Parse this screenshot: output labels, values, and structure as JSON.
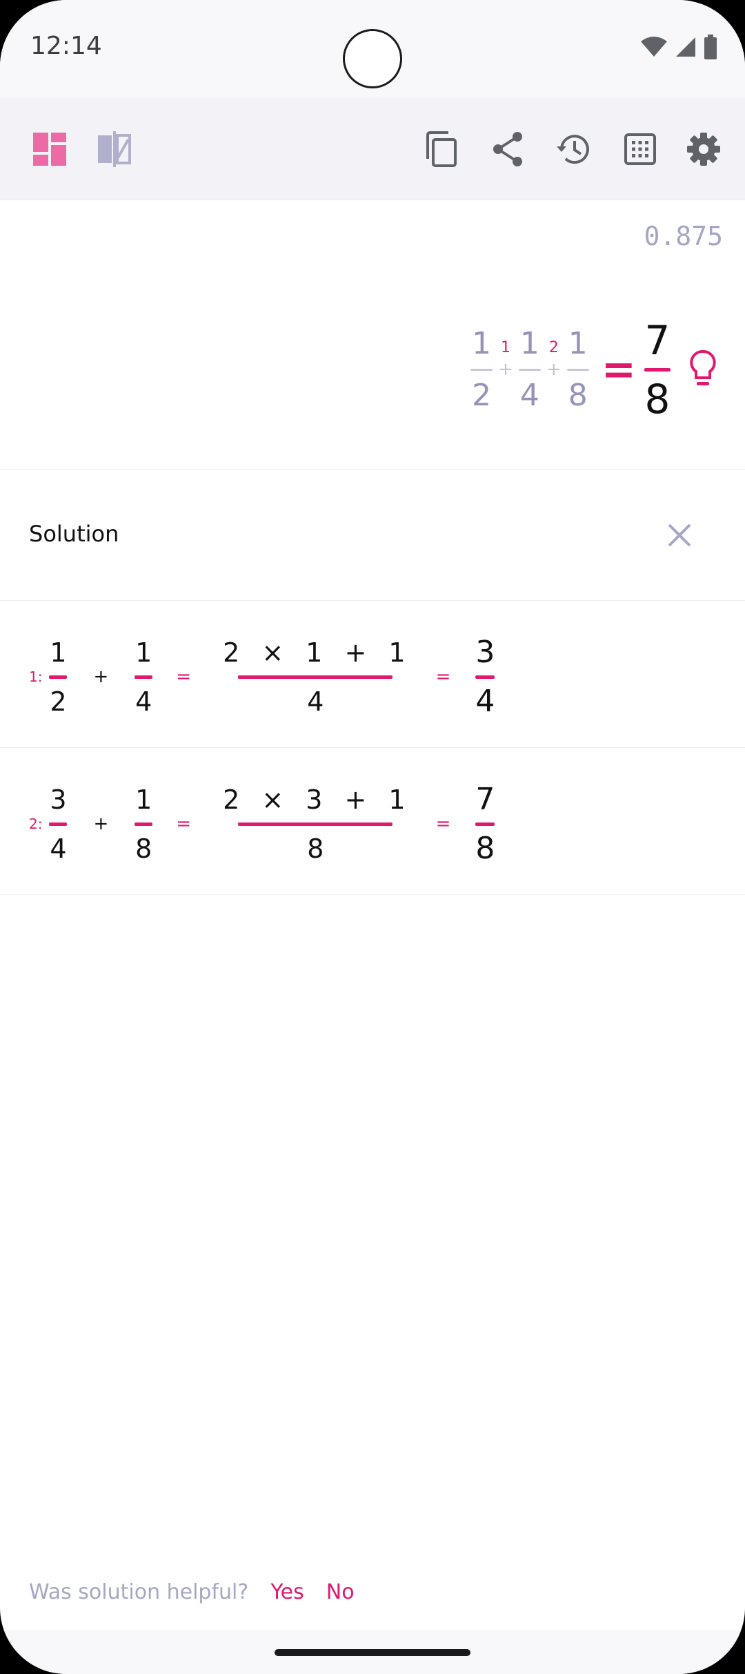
{
  "status_bar": {
    "time": "12:14"
  },
  "display": {
    "decimal": "0.875",
    "expression": {
      "terms": [
        {
          "num": "1",
          "den": "2"
        },
        {
          "num": "1",
          "den": "4"
        },
        {
          "num": "1",
          "den": "8"
        }
      ],
      "operators": [
        {
          "index": "1",
          "symbol": "+"
        },
        {
          "index": "2",
          "symbol": "+"
        }
      ],
      "equals": "=",
      "result": {
        "num": "7",
        "den": "8"
      }
    }
  },
  "solution": {
    "title": "Solution",
    "steps": [
      {
        "index": "1:",
        "a": {
          "num": "1",
          "den": "2"
        },
        "plus": "+",
        "b": {
          "num": "1",
          "den": "4"
        },
        "eq": "=",
        "calc": {
          "num": "2 × 1 + 1",
          "den": "4"
        },
        "eq2": "=",
        "result": {
          "num": "3",
          "den": "4"
        }
      },
      {
        "index": "2:",
        "a": {
          "num": "3",
          "den": "4"
        },
        "plus": "+",
        "b": {
          "num": "1",
          "den": "8"
        },
        "eq": "=",
        "calc": {
          "num": "2 × 3 + 1",
          "den": "8"
        },
        "eq2": "=",
        "result": {
          "num": "7",
          "den": "8"
        }
      }
    ]
  },
  "feedback": {
    "question": "Was solution helpful?",
    "yes": "Yes",
    "no": "No"
  },
  "colors": {
    "accent": "#e0196f",
    "muted": "#a6a6c4",
    "icon": "#5f6368"
  },
  "toolbar_icons": [
    "layout-icon",
    "split-screen-icon",
    "copy-icon",
    "share-icon",
    "history-icon",
    "keypad-icon",
    "settings-icon"
  ]
}
